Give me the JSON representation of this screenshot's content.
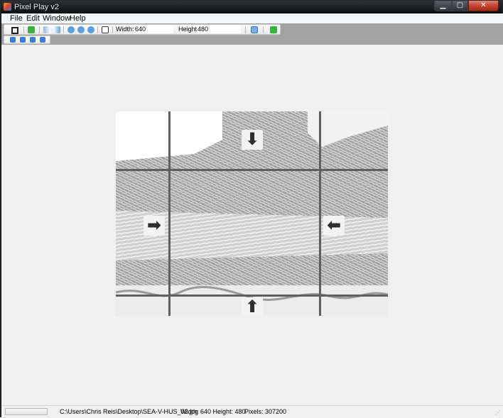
{
  "window": {
    "title": "Pixel Play v2",
    "min_label": "▁",
    "max_label": "▢",
    "close_label": "✕"
  },
  "menu": {
    "items": [
      "File",
      "Edit",
      "Window",
      "Help"
    ]
  },
  "toolbar": {
    "width_label": "Width:",
    "width_value": "640",
    "height_label": "Height:",
    "height_value": "480"
  },
  "arrows": {
    "down": "⬇",
    "up": "⬆",
    "right": "➡",
    "left": "⬅"
  },
  "statusbar": {
    "path": "C:\\Users\\Chris Reis\\Desktop\\SEA-V-HUS_02.jpg",
    "dimensions": "Width: 640 Height: 480",
    "pixels": "Pixels: 307200",
    "grip": "⋰"
  }
}
